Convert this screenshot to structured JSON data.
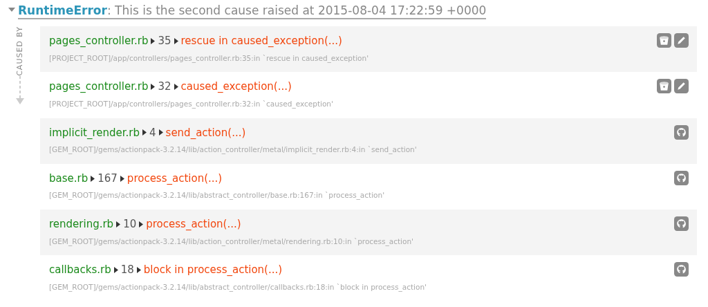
{
  "error": {
    "expanded": true,
    "class_name": "RuntimeError",
    "message": ": This is the second cause raised at 2015-08-04 17:22:59 +0000"
  },
  "caused_by_label": "CAUSED BY",
  "frames": [
    {
      "kind": "project",
      "file": "pages_controller.rb",
      "line": "35",
      "method": "rescue in caused_exception(...)",
      "path": "[PROJECT_ROOT]/app/controllers/pages_controller.rb:35:in `rescue in caused_exception'"
    },
    {
      "kind": "project",
      "file": "pages_controller.rb",
      "line": "32",
      "method": "caused_exception(...)",
      "path": "[PROJECT_ROOT]/app/controllers/pages_controller.rb:32:in `caused_exception'"
    },
    {
      "kind": "gem",
      "file": "implicit_render.rb",
      "line": "4",
      "method": "send_action(...)",
      "path": "[GEM_ROOT]/gems/actionpack-3.2.14/lib/action_controller/metal/implicit_render.rb:4:in `send_action'"
    },
    {
      "kind": "gem",
      "file": "base.rb",
      "line": "167",
      "method": "process_action(...)",
      "path": "[GEM_ROOT]/gems/actionpack-3.2.14/lib/abstract_controller/base.rb:167:in `process_action'"
    },
    {
      "kind": "gem",
      "file": "rendering.rb",
      "line": "10",
      "method": "process_action(...)",
      "path": "[GEM_ROOT]/gems/actionpack-3.2.14/lib/action_controller/metal/rendering.rb:10:in `process_action'"
    },
    {
      "kind": "gem",
      "file": "callbacks.rb",
      "line": "18",
      "method": "block in process_action(...)",
      "path": "[GEM_ROOT]/gems/actionpack-3.2.14/lib/abstract_controller/callbacks.rb:18:in `block in process_action'"
    }
  ]
}
